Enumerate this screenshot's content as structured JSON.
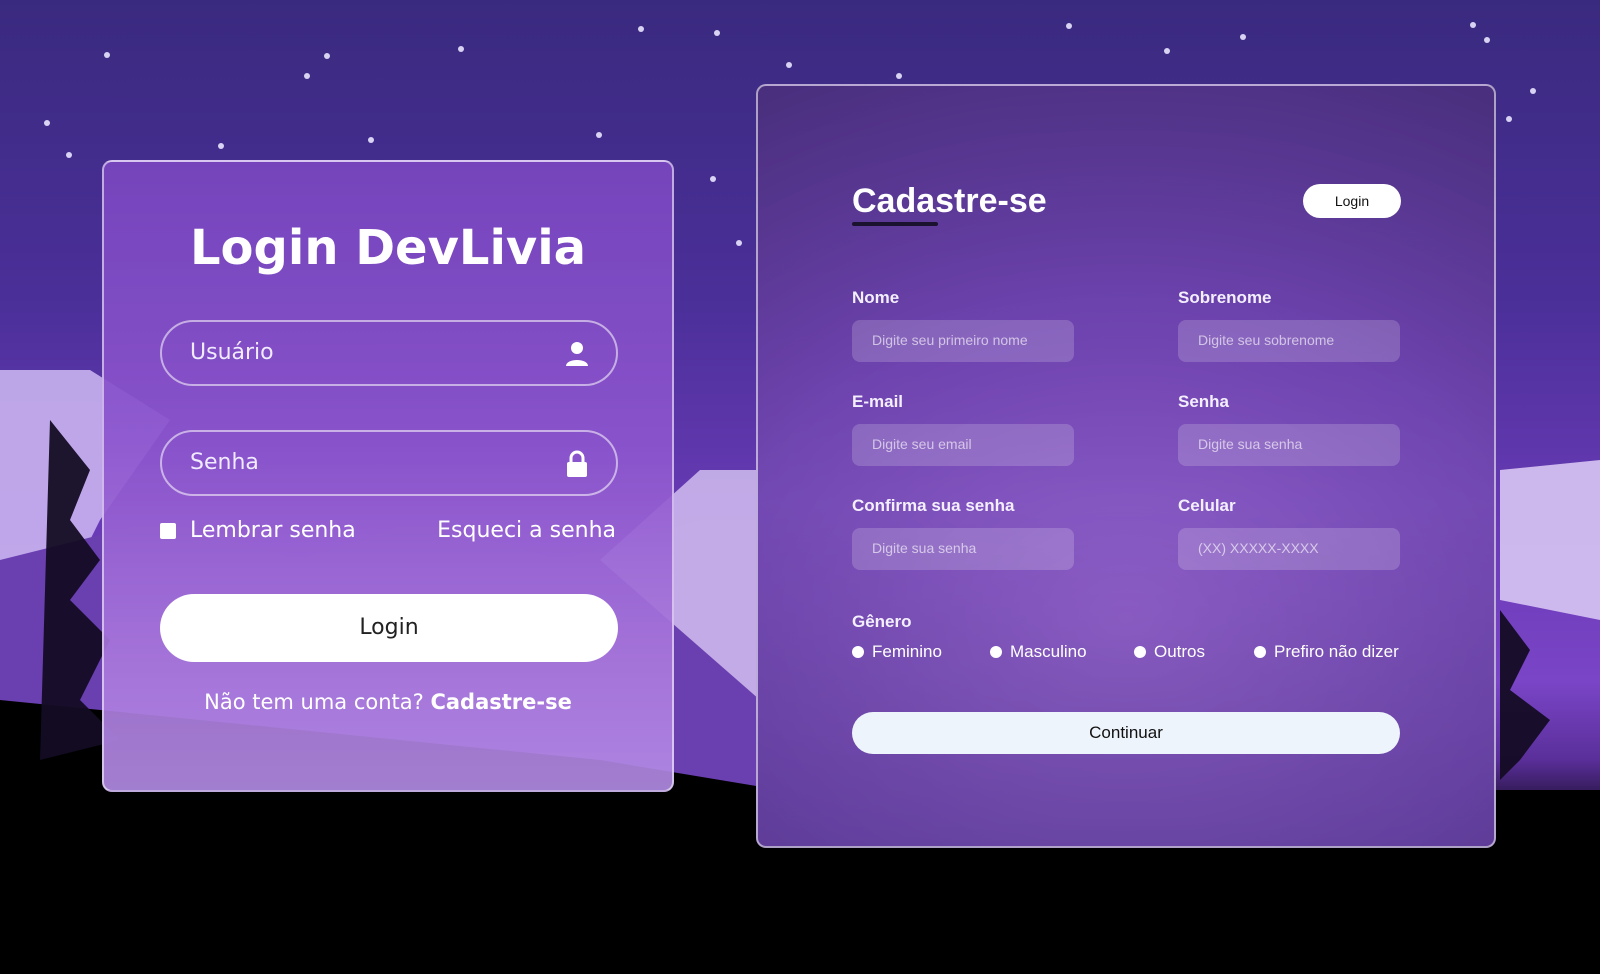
{
  "login": {
    "title": "Login DevLivia",
    "username_placeholder": "Usuário",
    "password_placeholder": "Senha",
    "remember_label": "Lembrar senha",
    "forgot_label": "Esqueci a senha",
    "login_button": "Login",
    "no_account_text": "Não tem uma conta?",
    "signup_link": "Cadastre-se",
    "icons": {
      "user": "user-icon",
      "lock": "lock-icon"
    }
  },
  "signup": {
    "title": "Cadastre-se",
    "login_button": "Login",
    "fields": {
      "nome": {
        "label": "Nome",
        "placeholder": "Digite seu primeiro nome"
      },
      "sobrenome": {
        "label": "Sobrenome",
        "placeholder": "Digite seu sobrenome"
      },
      "email": {
        "label": "E-mail",
        "placeholder": "Digite seu email"
      },
      "senha": {
        "label": "Senha",
        "placeholder": "Digite sua senha"
      },
      "confirma": {
        "label": "Confirma sua senha",
        "placeholder": "Digite sua senha"
      },
      "celular": {
        "label": "Celular",
        "placeholder": "(XX) XXXXX-XXXX"
      }
    },
    "gender": {
      "title": "Gênero",
      "options": [
        "Feminino",
        "Masculino",
        "Outros",
        "Prefiro não dizer"
      ]
    },
    "continue_button": "Continuar"
  },
  "colors": {
    "card_border": "#ffffff",
    "accent_dark": "#1b1230",
    "sky_top": "#3a2a7f"
  }
}
